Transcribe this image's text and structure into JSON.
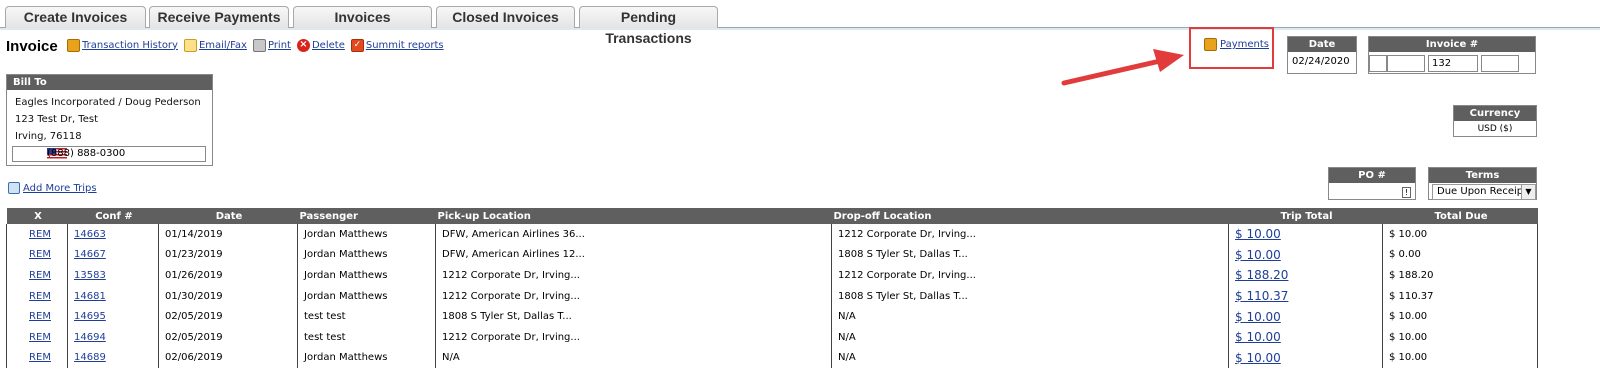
{
  "tabs": [
    {
      "label": "Create Invoices"
    },
    {
      "label": "Receive Payments"
    },
    {
      "label": "Invoices"
    },
    {
      "label": "Closed Invoices"
    },
    {
      "label": "Pending Transactions"
    }
  ],
  "title": "Invoice",
  "toolbar": {
    "history": "Transaction History",
    "email": "Email/Fax",
    "print": "Print",
    "delete": "Delete",
    "summit": "Summit reports"
  },
  "payments_label": "Payments",
  "bill_to": {
    "header": "Bill To",
    "line1": "Eagles Incorporated / Doug Pederson",
    "line2": "123 Test Dr, Test",
    "line3": "Irving,  76118",
    "phone": "(888) 888-0300"
  },
  "date": {
    "header": "Date",
    "value": "02/24/2020"
  },
  "invoice_no": {
    "header": "Invoice #",
    "value": "132"
  },
  "currency": {
    "header": "Currency",
    "value": "USD  ($)"
  },
  "po": {
    "header": "PO #",
    "value": ""
  },
  "terms": {
    "header": "Terms",
    "value": "Due Upon Receipt"
  },
  "add_more_trips": "Add More Trips",
  "columns": [
    "X",
    "Conf #",
    "Date",
    "Passenger",
    "Pick-up Location",
    "Drop-off Location",
    "Trip Total",
    "Total Due"
  ],
  "rows": [
    {
      "x": "REM",
      "conf": "14663",
      "date": "01/14/2019",
      "passenger": "Jordan Matthews",
      "pickup": "DFW, American Airlines 36...",
      "dropoff": "1212 Corporate Dr, Irving...",
      "trip_total": "$ 10.00",
      "total_due": "$ 10.00"
    },
    {
      "x": "REM",
      "conf": "14667",
      "date": "01/23/2019",
      "passenger": "Jordan Matthews",
      "pickup": "DFW, American Airlines 12...",
      "dropoff": "1808 S Tyler St, Dallas T...",
      "trip_total": "$ 10.00",
      "total_due": "$ 0.00"
    },
    {
      "x": "REM",
      "conf": "13583",
      "date": "01/26/2019",
      "passenger": "Jordan Matthews",
      "pickup": "1212 Corporate Dr, Irving...",
      "dropoff": "1212 Corporate Dr, Irving...",
      "trip_total": "$ 188.20",
      "total_due": "$ 188.20"
    },
    {
      "x": "REM",
      "conf": "14681",
      "date": "01/30/2019",
      "passenger": "Jordan Matthews",
      "pickup": "1212 Corporate Dr, Irving...",
      "dropoff": "1808 S Tyler St, Dallas T...",
      "trip_total": "$ 110.37",
      "total_due": "$ 110.37"
    },
    {
      "x": "REM",
      "conf": "14695",
      "date": "02/05/2019",
      "passenger": "test test",
      "pickup": "1808 S Tyler St, Dallas T...",
      "dropoff": "N/A",
      "trip_total": "$ 10.00",
      "total_due": "$ 10.00"
    },
    {
      "x": "REM",
      "conf": "14694",
      "date": "02/05/2019",
      "passenger": "test test",
      "pickup": "1212 Corporate Dr, Irving...",
      "dropoff": "N/A",
      "trip_total": "$ 10.00",
      "total_due": "$ 10.00"
    },
    {
      "x": "REM",
      "conf": "14689",
      "date": "02/06/2019",
      "passenger": "Jordan Matthews",
      "pickup": "N/A",
      "dropoff": "N/A",
      "trip_total": "$ 10.00",
      "total_due": "$ 10.00"
    }
  ],
  "colors": {
    "header_bg": "#5f5f5f",
    "link": "#1f3e99",
    "highlight": "#e23b3b"
  }
}
